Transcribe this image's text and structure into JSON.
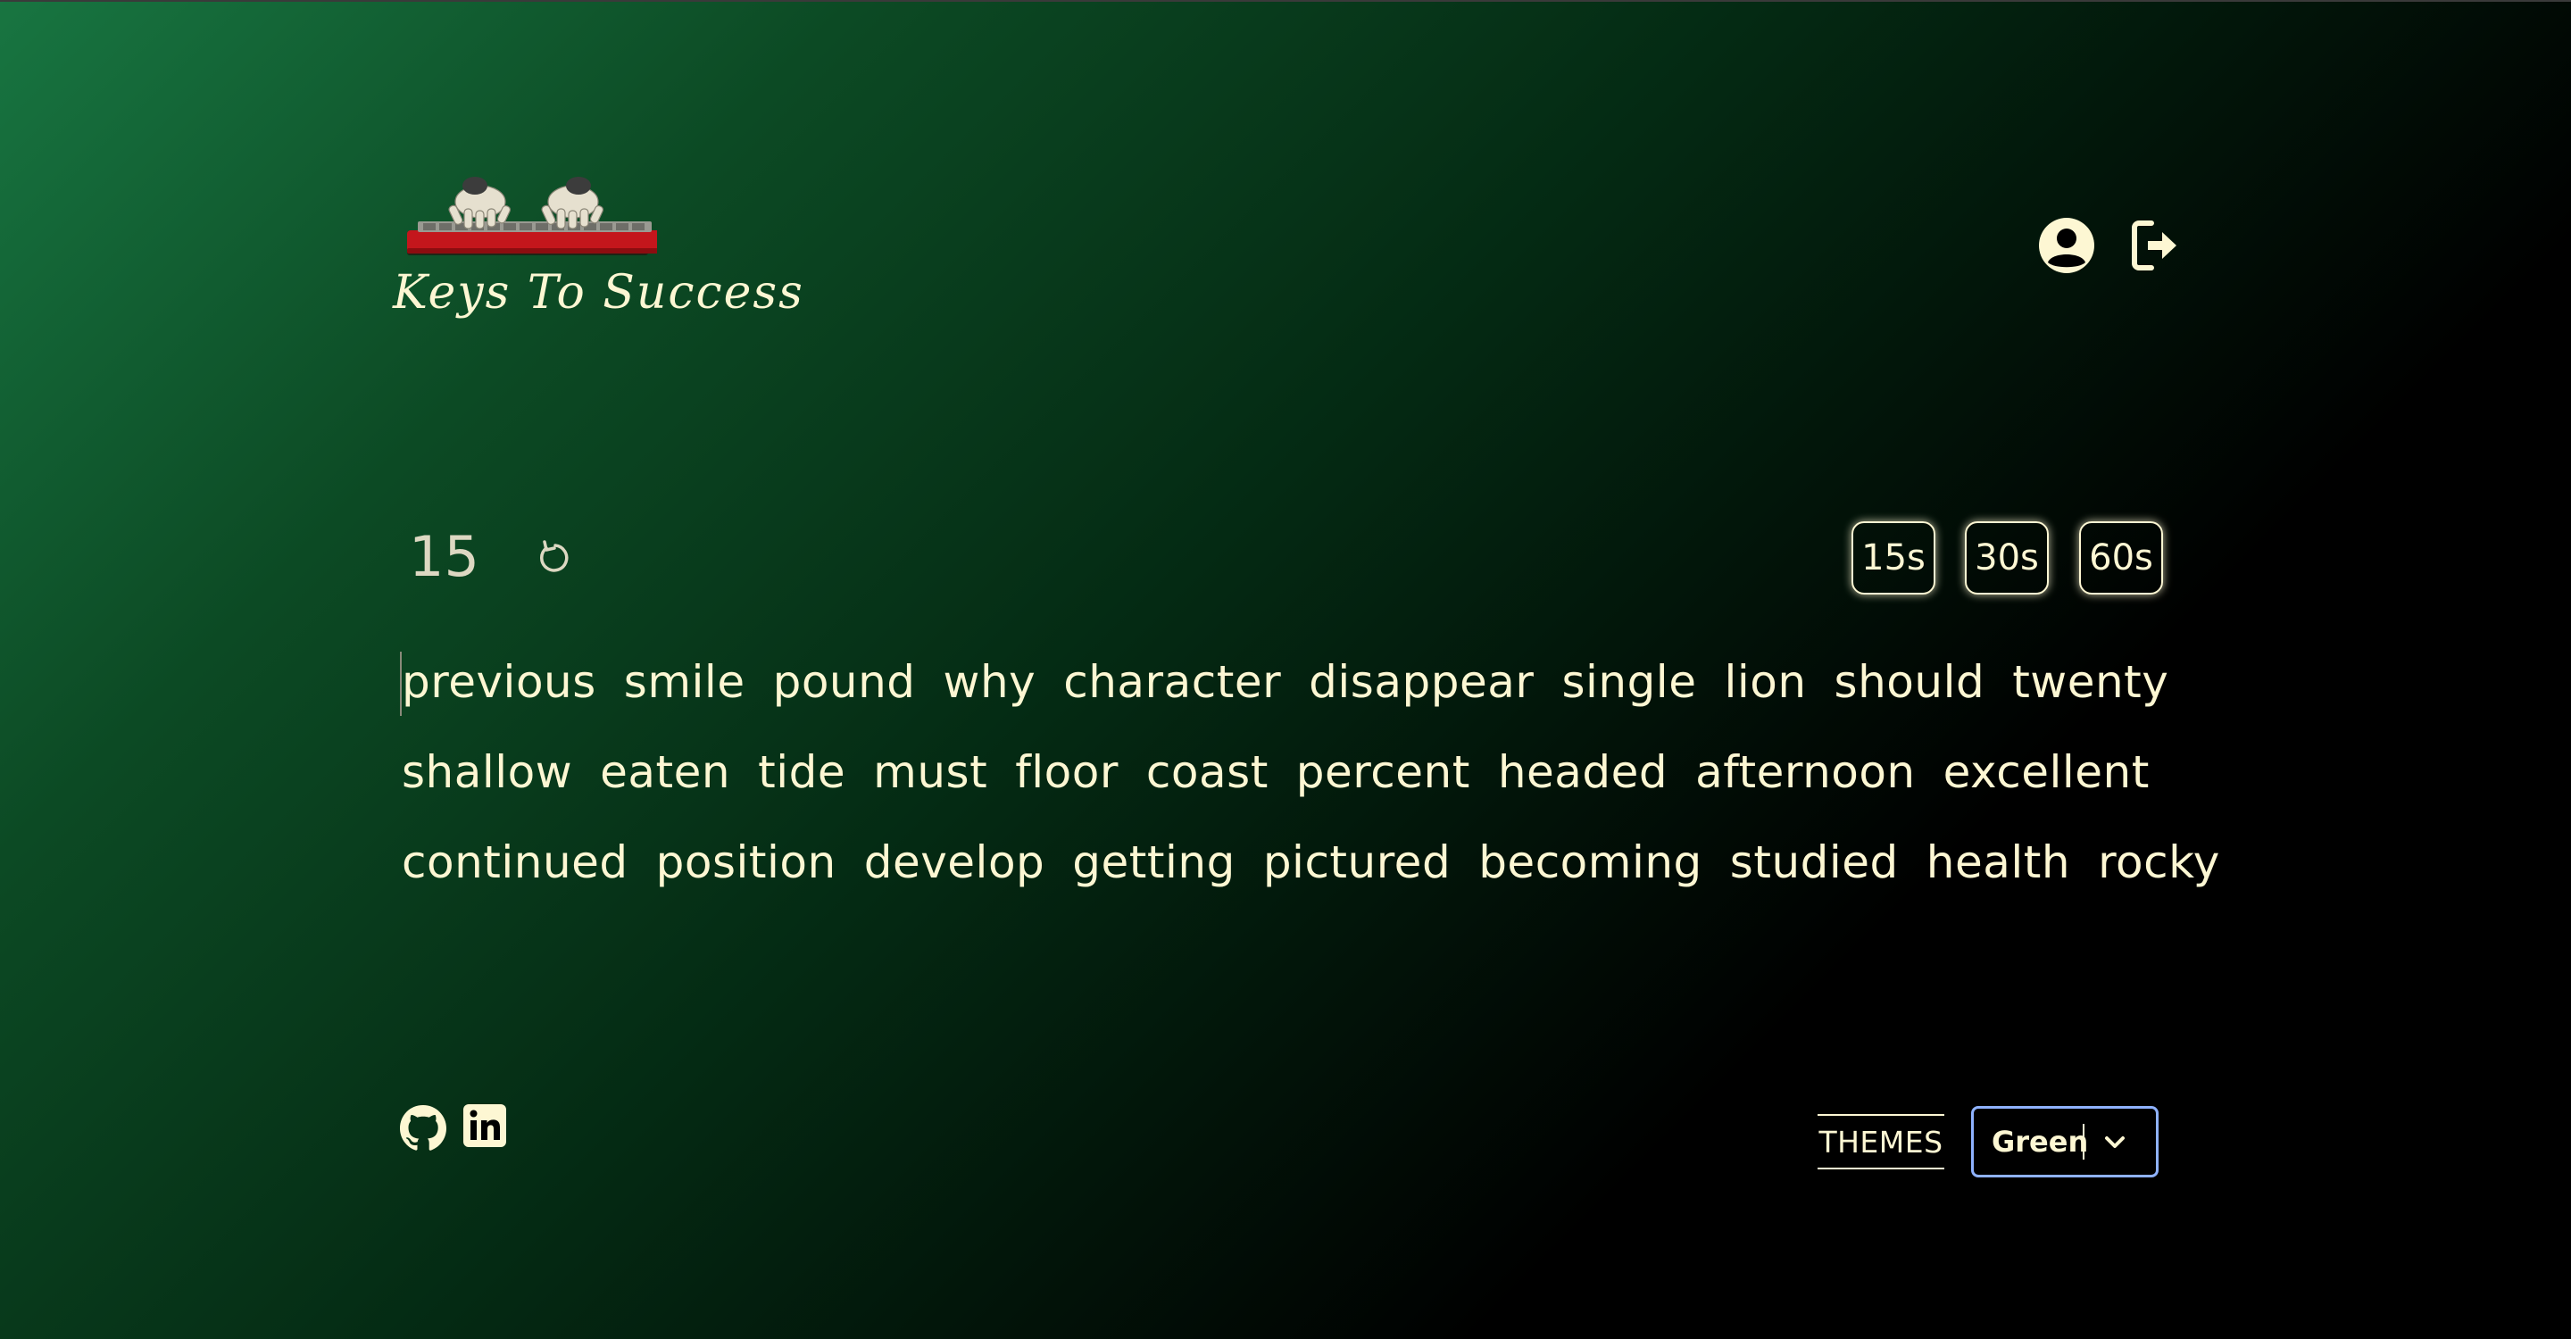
{
  "app": {
    "title": "Keys To Success"
  },
  "header": {
    "profile_icon": "user-circle-icon",
    "logout_icon": "sign-out-icon"
  },
  "test": {
    "timer": "15",
    "restart_icon": "restart-icon",
    "durations": [
      "15s",
      "30s",
      "60s"
    ]
  },
  "words": [
    [
      "previous",
      "smile",
      "pound",
      "why",
      "character",
      "disappear",
      "single",
      "lion",
      "should",
      "twenty"
    ],
    [
      "shallow",
      "eaten",
      "tide",
      "must",
      "floor",
      "coast",
      "percent",
      "headed",
      "afternoon",
      "excellent"
    ],
    [
      "continued",
      "position",
      "develop",
      "getting",
      "pictured",
      "becoming",
      "studied",
      "health",
      "rocky"
    ]
  ],
  "footer": {
    "github_icon": "github-icon",
    "linkedin_icon": "linkedin-icon",
    "themes_label": "THEMES",
    "theme_selected": "Green"
  },
  "colors": {
    "text": "#fdf7d3",
    "gradient_start": "#187541",
    "gradient_end": "#000000",
    "select_border": "#8fb2ff",
    "logo_red": "#c4161c"
  }
}
